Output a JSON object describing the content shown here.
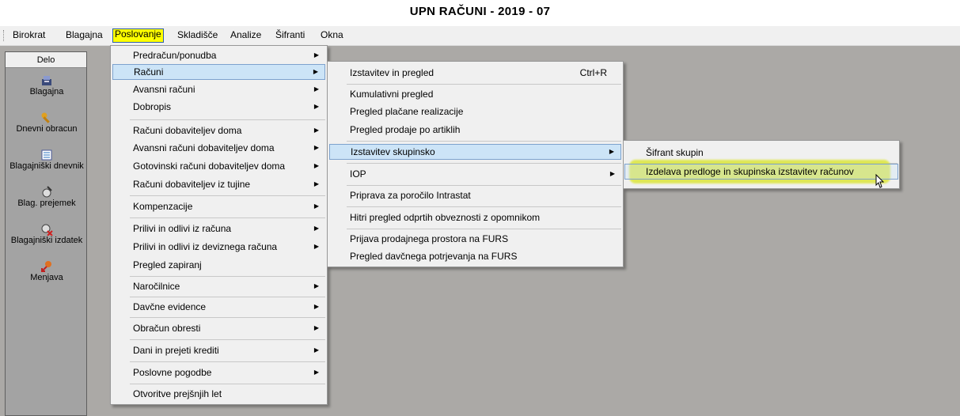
{
  "window": {
    "title": "UPN RAČUNI - 2019 - 07"
  },
  "menubar": {
    "items": [
      "Birokrat",
      "Blagajna",
      "Poslovanje",
      "Skladišče",
      "Analize",
      "Šifranti",
      "Okna"
    ],
    "active": "Poslovanje"
  },
  "sidebar": {
    "header": "Delo",
    "items": [
      {
        "label": "Blagajna",
        "icon": "cash-register-icon"
      },
      {
        "label": "Dnevni obracun",
        "icon": "wrench-icon"
      },
      {
        "label": "Blagajniški dnevnik",
        "icon": "journal-icon"
      },
      {
        "label": "Blag. prejemek",
        "icon": "receipt-in-icon"
      },
      {
        "label": "Blagajniški izdatek",
        "icon": "receipt-out-icon"
      },
      {
        "label": "Menjava",
        "icon": "exchange-icon"
      }
    ]
  },
  "menu_poslovanje": {
    "items": [
      "Predračun/ponudba",
      "Računi",
      "Avansni računi",
      "Dobropis",
      "Računi dobaviteljev doma",
      "Avansni računi dobaviteljev doma",
      "Gotovinski računi dobaviteljev doma",
      "Računi dobaviteljev iz tujine",
      "Kompenzacije",
      "Prilivi in odlivi iz računa",
      "Prilivi in odlivi iz deviznega računa",
      "Pregled zapiranj",
      "Naročilnice",
      "Davčne evidence",
      "Obračun obresti",
      "Dani in prejeti krediti",
      "Poslovne pogodbe",
      "Otvoritve prejšnjih let"
    ],
    "highlighted": "Računi"
  },
  "menu_racuni": {
    "items": [
      "Izstavitev in pregled",
      "Kumulativni pregled",
      "Pregled plačane realizacije",
      "Pregled prodaje po artiklih",
      "Izstavitev skupinsko",
      "IOP",
      "Priprava za poročilo Intrastat",
      "Hitri pregled odprtih obveznosti z opomnikom",
      "Prijava prodajnega prostora na FURS",
      "Pregled davčnega potrjevanja na FURS"
    ],
    "shortcut": "Ctrl+R",
    "highlighted": "Izstavitev skupinsko"
  },
  "menu_skupinsko": {
    "items": [
      "Šifrant skupin",
      "Izdelava predloge in skupinska izstavitev računov"
    ],
    "highlighted": "Izdelava predloge in skupinska izstavitev računov"
  },
  "colors": {
    "menu_bg": "#f0f0f0",
    "highlight": "#cce4f7",
    "highlight_border": "#7da2ce",
    "workspace": "#aba9a6",
    "annotation": "#dce63a",
    "active_menu": "#ffff00"
  }
}
